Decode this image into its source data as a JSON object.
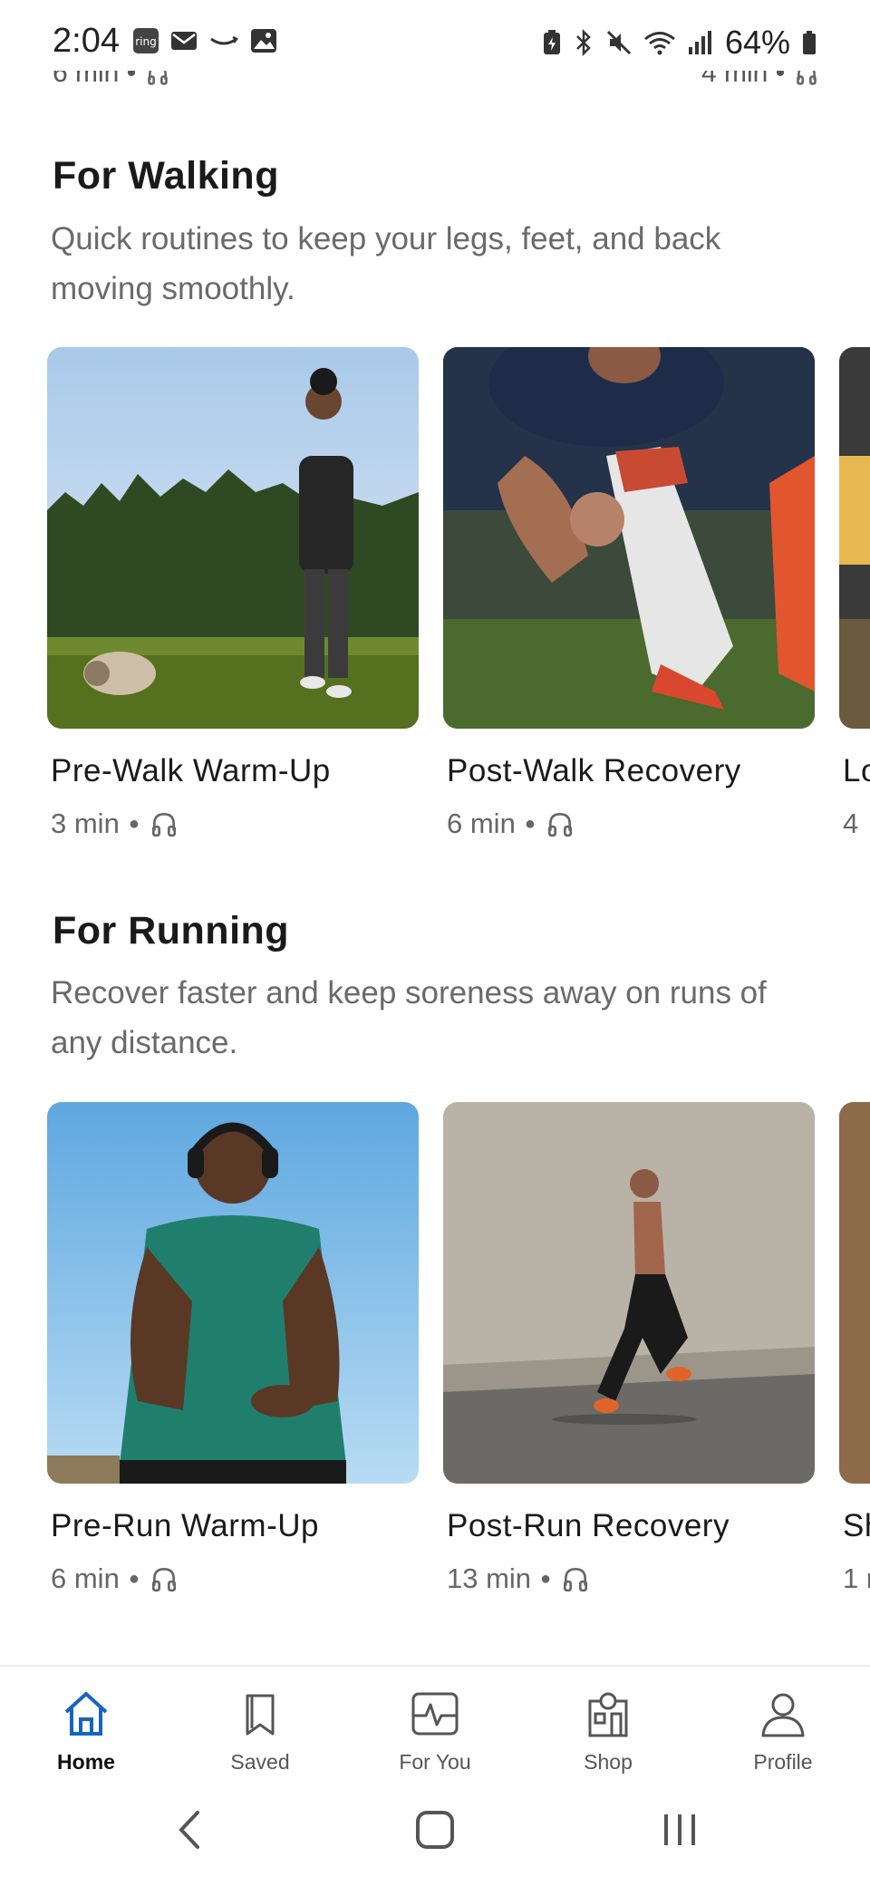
{
  "status_bar": {
    "time": "2:04",
    "battery_text": "64%"
  },
  "peek": {
    "left_meta": "6 min •",
    "right_meta": "4 min •"
  },
  "walking": {
    "title": "For Walking",
    "subtitle": "Quick routines to keep your legs, feet, and back moving smoothly.",
    "cards": [
      {
        "title": "Pre-Walk Warm-Up",
        "duration": "3 min"
      },
      {
        "title": "Post-Walk Recovery",
        "duration": "6 min"
      },
      {
        "title": "Lo",
        "duration": "4"
      }
    ]
  },
  "running": {
    "title": "For Running",
    "subtitle": "Recover faster and keep soreness away on runs of any distance.",
    "cards": [
      {
        "title": "Pre-Run Warm-Up",
        "duration": "6 min"
      },
      {
        "title": "Post-Run Recovery",
        "duration": "13 min"
      },
      {
        "title": "Sh",
        "duration": "1 r"
      }
    ]
  },
  "nav": {
    "items": [
      {
        "label": "Home",
        "icon": "home-icon",
        "active": true
      },
      {
        "label": "Saved",
        "icon": "bookmark-icon"
      },
      {
        "label": "For You",
        "icon": "heartbeat-icon"
      },
      {
        "label": "Shop",
        "icon": "shop-icon"
      },
      {
        "label": "Profile",
        "icon": "profile-icon"
      }
    ]
  },
  "colors": {
    "accent": "#1565c0",
    "text": "#1a1a1a",
    "subtle_text": "#6a6a6a"
  }
}
